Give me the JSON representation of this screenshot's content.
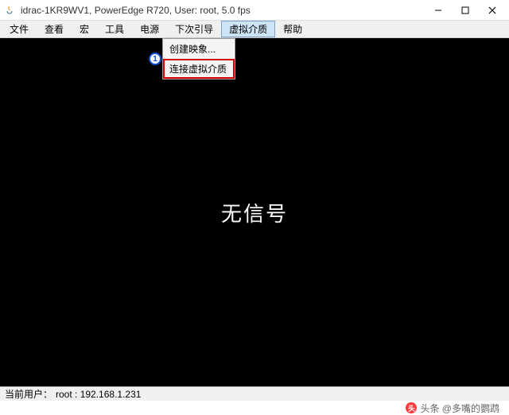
{
  "window": {
    "title": "idrac-1KR9WV1, PowerEdge R720, User: root, 5.0 fps"
  },
  "menubar": {
    "items": [
      "文件",
      "查看",
      "宏",
      "工具",
      "电源",
      "下次引导",
      "虚拟介质",
      "帮助"
    ],
    "active_index": 6
  },
  "dropdown": {
    "items": [
      {
        "label": "创建映象..."
      },
      {
        "label": "连接虚拟介质"
      }
    ],
    "highlighted_index": 1
  },
  "callout": {
    "number": "1"
  },
  "viewport": {
    "no_signal": "无信号"
  },
  "statusbar": {
    "label": "当前用户：",
    "value": "root : 192.168.1.231"
  },
  "watermark": {
    "logo": "头",
    "text": "头条 @多嘴的鹦鹉"
  }
}
